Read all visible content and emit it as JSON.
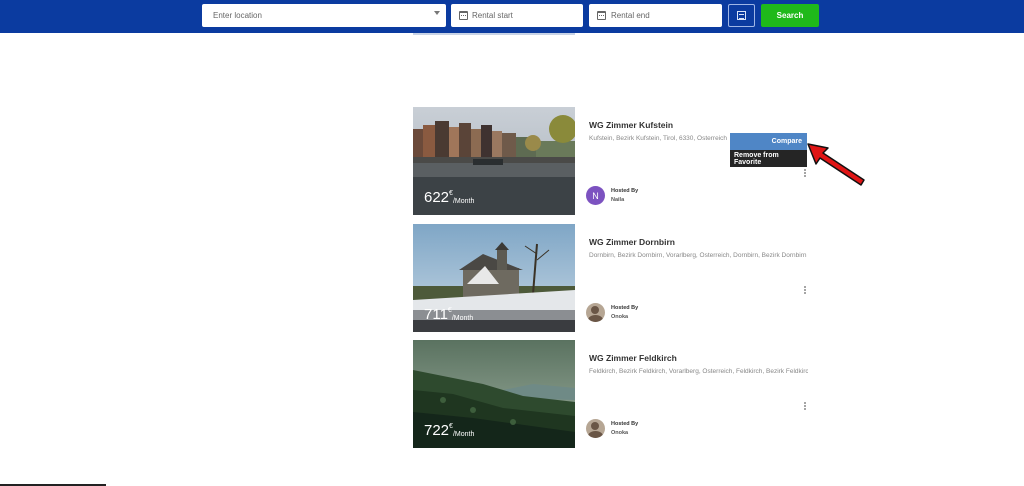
{
  "search": {
    "location_placeholder": "Enter location",
    "rental_start_placeholder": "Rental start",
    "rental_end_placeholder": "Rental end",
    "search_label": "Search"
  },
  "listings": [
    {
      "title": "WG Zimmer Kufstein",
      "address": "Kufstein, Bezirk Kufstein, Tirol, 6330, Österreich",
      "price": "622",
      "currency": "€",
      "period": "/Month",
      "hosted_by_label": "Hosted By",
      "host": "Naila",
      "host_initial": "N"
    },
    {
      "title": "WG Zimmer Dornbirn",
      "address": "Dornbirn, Bezirk Dornbirn, Vorarlberg, Österreich, Dornbirn, Bezirk Dornbirn",
      "price": "711",
      "currency": "€",
      "period": "/Month",
      "hosted_by_label": "Hosted By",
      "host": "Onoka"
    },
    {
      "title": "WG Zimmer Feldkirch",
      "address": "Feldkirch, Bezirk Feldkirch, Vorarlberg, Österreich, Feldkirch, Bezirk Feldkirch",
      "price": "722",
      "currency": "€",
      "period": "/Month",
      "hosted_by_label": "Hosted By",
      "host": "Onoka"
    }
  ],
  "context_menu": {
    "compare_label": "Compare",
    "remove_label": "Remove from Favorite"
  },
  "colors": {
    "topbar": "#0b3ba0",
    "search_button": "#1fb91a",
    "compare": "#4f86c6",
    "remove": "#252525",
    "annotation_arrow": "#e01515"
  }
}
